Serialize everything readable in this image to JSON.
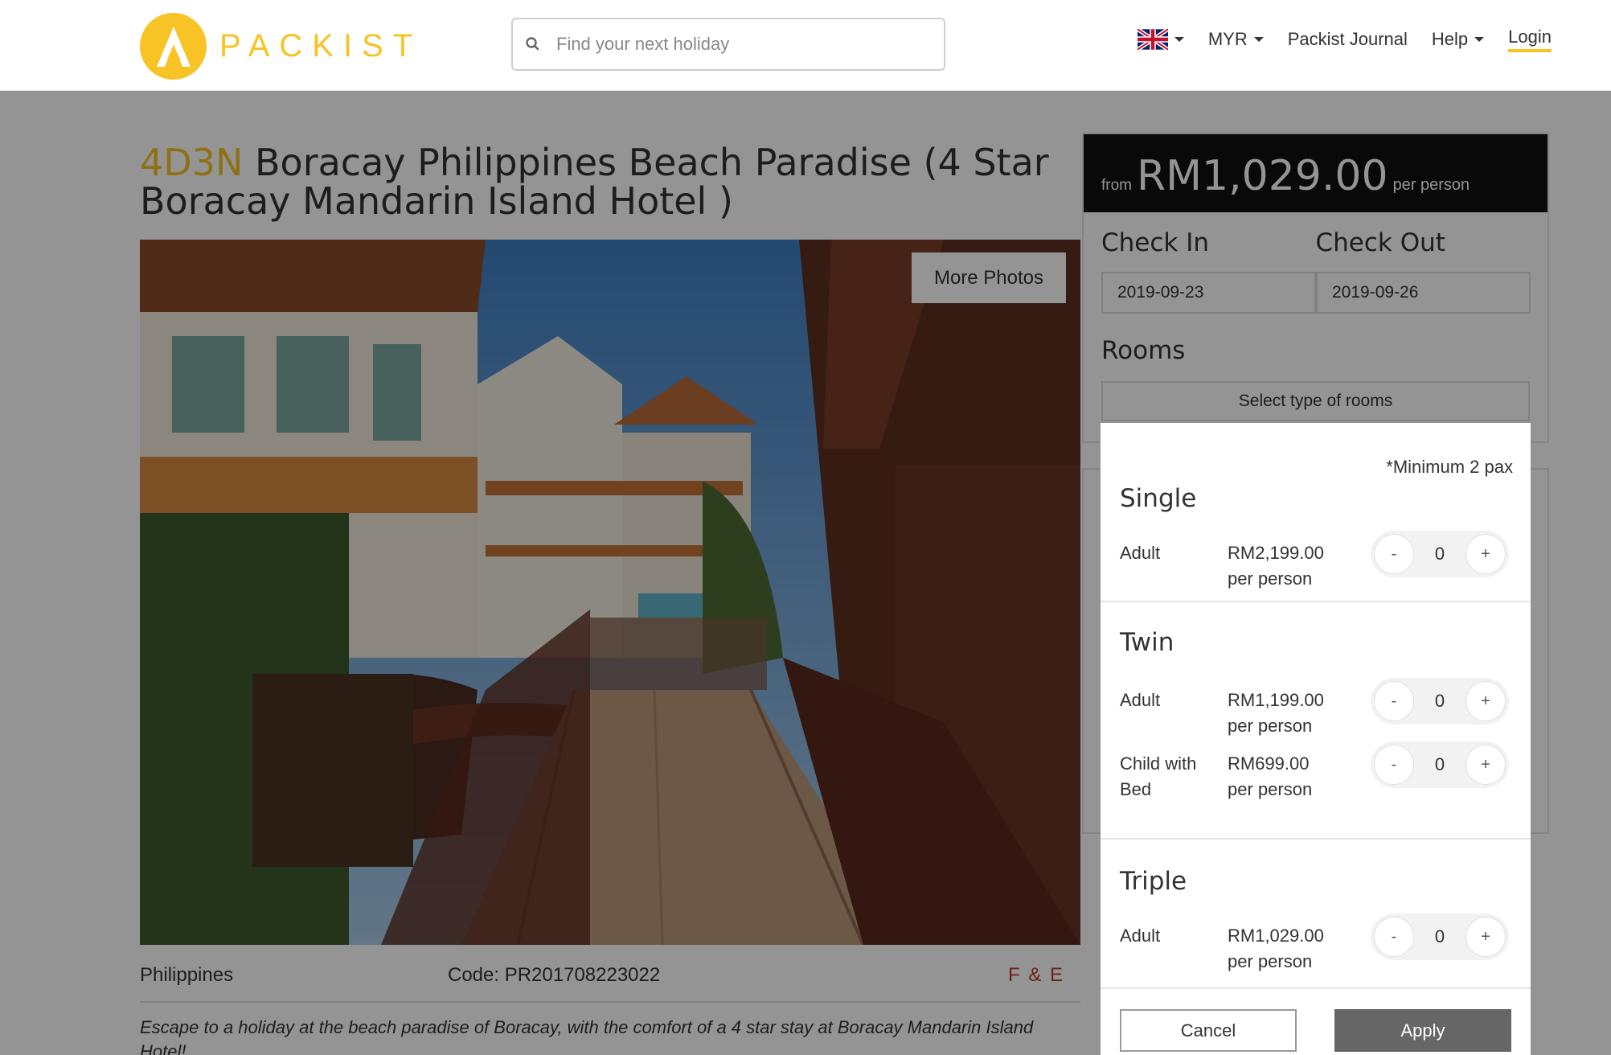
{
  "header": {
    "logo_text": "PACKIST",
    "search_placeholder": "Find your next holiday",
    "currency": "MYR",
    "journal": "Packist Journal",
    "help": "Help",
    "login": "Login",
    "language_icon": "uk-flag-icon"
  },
  "colors": {
    "brand_yellow": "#f7c325",
    "price_bar": "#111111",
    "accent_red": "#c0392b",
    "apply_button": "#666666"
  },
  "tour": {
    "tag": "4D3N",
    "title": "Boracay Philippines Beach Paradise (4 Star Boracay Mandarin Island Hotel )",
    "more_photos": "More Photos",
    "country": "Philippines",
    "code": "Code: PR201708223022",
    "category": "F & E",
    "description": "Escape to a holiday at the beach paradise of Boracay, with the comfort of a 4 star stay at Boracay Mandarin Island Hotel!"
  },
  "booking": {
    "from": "from",
    "price": "RM1,029.00",
    "per_person": "per person",
    "check_in_label": "Check In",
    "check_out_label": "Check Out",
    "check_in": "2019-09-23",
    "check_out": "2019-09-26",
    "rooms_label": "Rooms",
    "rooms_select": "Select type of rooms"
  },
  "room_dropdown": {
    "min_pax": "*Minimum 2 pax",
    "groups": [
      {
        "name": "Single",
        "rows": [
          {
            "label": "Adult",
            "price": "RM2,199.00",
            "unit": "per person",
            "qty": "0"
          }
        ]
      },
      {
        "name": "Twin",
        "rows": [
          {
            "label": "Adult",
            "price": "RM1,199.00",
            "unit": "per person",
            "qty": "0"
          },
          {
            "label": "Child with Bed",
            "price": "RM699.00",
            "unit": "per person",
            "qty": "0"
          }
        ]
      },
      {
        "name": "Triple",
        "rows": [
          {
            "label": "Adult",
            "price": "RM1,029.00",
            "unit": "per person",
            "qty": "0"
          }
        ]
      }
    ],
    "minus": "-",
    "plus": "+",
    "cancel": "Cancel",
    "apply": "Apply"
  }
}
